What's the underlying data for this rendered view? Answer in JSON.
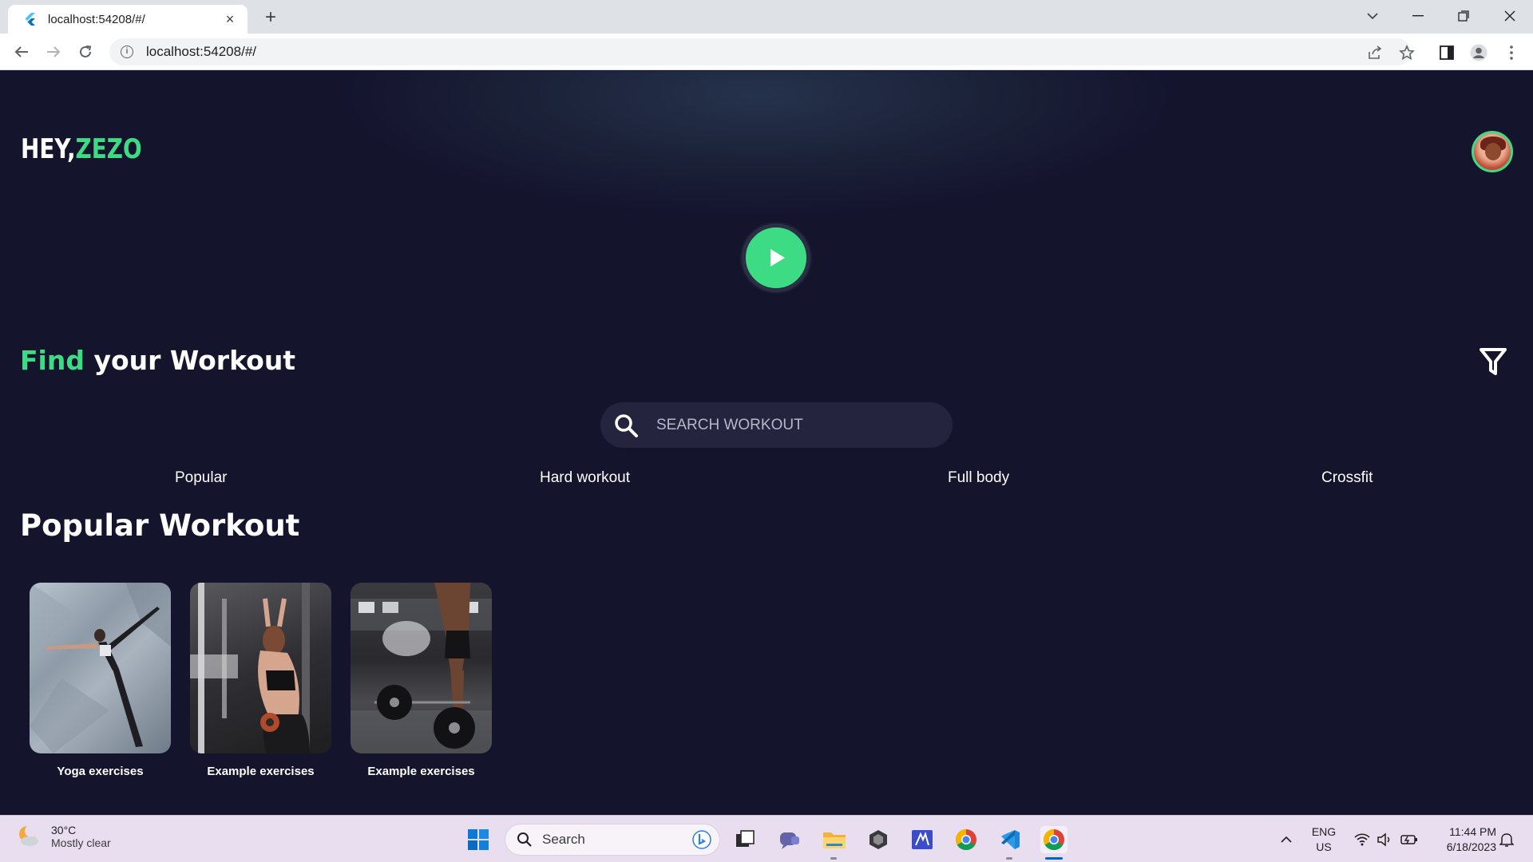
{
  "browser": {
    "tab_title": "localhost:54208/#/",
    "url": "localhost:54208/#/",
    "new_tab_glyph": "+",
    "close_glyph": "×"
  },
  "app": {
    "greeting_hey": "HEY,",
    "greeting_name": "ZEZO",
    "find_word": "Find",
    "find_rest": " your Workout",
    "search_placeholder": "SEARCH WORKOUT",
    "categories": [
      "Popular",
      "Hard workout",
      "Full body",
      "Crossfit"
    ],
    "section_title": "Popular Workout",
    "cards": [
      {
        "label": "Yoga exercises"
      },
      {
        "label": "Example exercises"
      },
      {
        "label": "Example exercises"
      }
    ],
    "colors": {
      "accent": "#3ddc84",
      "background": "#14142d",
      "search_bg": "#24243f"
    }
  },
  "taskbar": {
    "weather_temp": "30°C",
    "weather_desc": "Mostly clear",
    "search_label": "Search",
    "lang_line1": "ENG",
    "lang_line2": "US",
    "time": "11:44 PM",
    "date": "6/18/2023"
  }
}
